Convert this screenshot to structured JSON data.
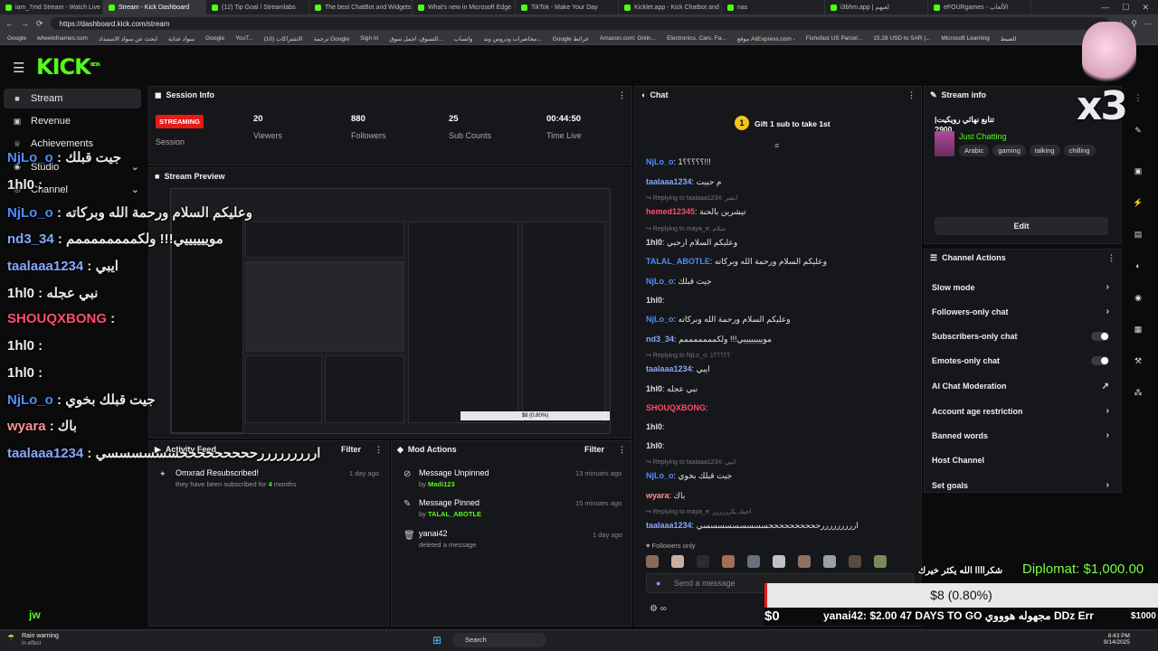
{
  "browser": {
    "tabs": [
      "iam_7md Stream - Watch Live o",
      "Stream - Kick Dashboard",
      "(12) Tip Goal / Streamlabs",
      "The best ChatBot and Widgets",
      "What's new in Microsoft Edge",
      "TikTok - Make Your Day",
      "Kicklet.app - Kick Chatbot and",
      "nas",
      "i3bhm.app | لعبهم",
      "eFOURgames - الألعاب"
    ],
    "url": "https://dashboard.kick.com/stream",
    "bookmarks": [
      "Google",
      "wheelofnames.com",
      "ابحث عن سواد الاستبداد",
      "سواد غداية",
      "Google",
      "YouT...",
      "الاشتراكات (10)",
      "ترجمة Google",
      "Sign In",
      "التسوق، اجمل سوق...",
      "واتساب",
      "محاضرات ودروس وند...",
      "Google خرائط",
      "Amazon.com: Onlin...",
      "Electronics, Cars, Fa...",
      "موقع AliExpress.com -",
      "Fishsfast US Parcel...",
      "15.28 USD to SAR |...",
      "Microsoft Learning",
      "الضبط"
    ]
  },
  "app": {
    "logo": "KICK",
    "logo_beta": "BETA"
  },
  "sidebar": {
    "items": [
      {
        "label": "Stream",
        "icon": "video-icon"
      },
      {
        "label": "Revenue",
        "icon": "dollar-icon"
      },
      {
        "label": "Achievements",
        "icon": "trophy-icon"
      },
      {
        "label": "Studio",
        "icon": "studio-icon"
      },
      {
        "label": "Channel",
        "icon": "channel-icon"
      }
    ],
    "footer_logo": "jw"
  },
  "session": {
    "title": "Session Info",
    "status": "STREAMING",
    "status_label": "Session",
    "stats": [
      {
        "value": "20",
        "label": "Viewers"
      },
      {
        "value": "880",
        "label": "Followers"
      },
      {
        "value": "25",
        "label": "Sub Counts"
      },
      {
        "value": "00:44:50",
        "label": "Time Live"
      }
    ]
  },
  "preview": {
    "title": "Stream Preview"
  },
  "activity": {
    "title": "Activity Feed",
    "filter": "Filter",
    "items": [
      {
        "title": "Omxrad Resubscribed!",
        "sub": "they have been subscribed for",
        "count": "4",
        "unit": "months",
        "time": "1 day ago"
      }
    ]
  },
  "modactions": {
    "title": "Mod Actions",
    "filter": "Filter",
    "items": [
      {
        "title": "Message Unpinned",
        "by": "by",
        "user": "Madi123",
        "time": "13 minutes ago"
      },
      {
        "title": "Message Pinned",
        "by": "by",
        "user": "TALAL_ABOTLE",
        "time": "15 minutes ago"
      },
      {
        "title": "yanai42",
        "by": "deleted a message",
        "user": "",
        "time": "1 day ago"
      }
    ]
  },
  "chat": {
    "title": "Chat",
    "gift": "Gift 1 sub to take 1st",
    "gift_rank": "1",
    "messages": [
      {
        "type": "msg",
        "user": "NjLo_o",
        "text": "؟؟؟؟؟1!!!",
        "color": "#4c8dff"
      },
      {
        "type": "msg",
        "user": "taalaaa1234",
        "text": "م حبيت",
        "color": "#86a8ff"
      },
      {
        "type": "reply",
        "text": "Replying to taalaaa1234: ابشر"
      },
      {
        "type": "msg",
        "user": "hemed12345",
        "text": "تيشرين بالحنة",
        "color": "#ff4d6d"
      },
      {
        "type": "reply",
        "text": "Replying to maya_e: سلام"
      },
      {
        "type": "msg",
        "user": "1hl0",
        "text": "وعليكم السلام ارحبي",
        "color": "#dddddd"
      },
      {
        "type": "msg",
        "user": "TALAL_ABOTLE",
        "text": "وعليكم السلام ورحمة الله وبركاته",
        "color": "#4c8dff"
      },
      {
        "type": "msg",
        "user": "NjLo_o",
        "text": "جيت قبلك",
        "color": "#4c8dff"
      },
      {
        "type": "msg",
        "user": "1hl0",
        "text": "",
        "color": "#dddddd"
      },
      {
        "type": "msg",
        "user": "NjLo_o",
        "text": "وعليكم السلام ورحمة الله وبركاته",
        "color": "#4c8dff"
      },
      {
        "type": "msg",
        "user": "nd3_34",
        "text": "موييييييييي!!! ولكمممممممم",
        "color": "#86a8ff"
      },
      {
        "type": "reply",
        "text": "Replying to NjLo_o: ؟؟؟؟؟1"
      },
      {
        "type": "msg",
        "user": "taalaaa1234",
        "text": "ايبي",
        "color": "#86a8ff"
      },
      {
        "type": "msg",
        "user": "1hl0",
        "text": "نبي عجله",
        "color": "#dddddd"
      },
      {
        "type": "msg",
        "user": "SHOUQXBONG",
        "text": "",
        "color": "#ff4d6d"
      },
      {
        "type": "msg",
        "user": "1hl0",
        "text": "",
        "color": "#dddddd"
      },
      {
        "type": "msg",
        "user": "1hl0",
        "text": "",
        "color": "#dddddd"
      },
      {
        "type": "reply",
        "text": "Replying to taalaaa1234: ابيي"
      },
      {
        "type": "msg",
        "user": "NjLo_o",
        "text": "جيت قبلك بخوي",
        "color": "#4c8dff"
      },
      {
        "type": "msg",
        "user": "wyara",
        "text": "باك",
        "color": "#ff9090"
      },
      {
        "type": "reply",
        "text": "Replying to maya_e: اجيك يكرررررر"
      },
      {
        "type": "msg",
        "user": "taalaaa1234",
        "text": "ارررررررررححححححححححسسسسسسسسسي",
        "color": "#86a8ff"
      }
    ],
    "followers_only": "Followers only",
    "input_placeholder": "Send a message"
  },
  "streaminfo": {
    "title": "Stream info",
    "stream_title": "تتابع نهائي رويكيت| 900?",
    "category": "Just Chatting",
    "tags": [
      "Arabic",
      "gaming",
      "talking",
      "chilling"
    ],
    "edit": "Edit"
  },
  "channelactions": {
    "title": "Channel Actions",
    "items": [
      {
        "label": "Slow mode",
        "control": "chevron"
      },
      {
        "label": "Followers-only chat",
        "control": "chevron"
      },
      {
        "label": "Subscribers-only chat",
        "control": "toggle"
      },
      {
        "label": "Emotes-only chat",
        "control": "toggle"
      },
      {
        "label": "AI Chat Moderation",
        "control": "external"
      },
      {
        "label": "Account age restriction",
        "control": "chevron"
      },
      {
        "label": "Banned words",
        "control": "chevron"
      },
      {
        "label": "Host Channel",
        "control": "none"
      },
      {
        "label": "Set goals",
        "control": "chevron"
      }
    ]
  },
  "overlay": {
    "chat": [
      {
        "user": "NjLo_o",
        "text": ": جيت قبلك",
        "color": "#4c8dff"
      },
      {
        "user": "1hl0",
        "text": ":",
        "color": "#eeeeee"
      },
      {
        "user": "NjLo_o",
        "text": ": وعليكم السلام ورحمة الله وبركاته",
        "color": "#4c8dff"
      },
      {
        "user": "nd3_34",
        "text": ": موييييييي!!! ولكممممممممم",
        "color": "#86a8ff"
      },
      {
        "user": "taalaaa1234",
        "text": ": ايبي",
        "color": "#86a8ff"
      },
      {
        "user": "1hl0",
        "text": ": نبي عجله",
        "color": "#eeeeee"
      },
      {
        "user": "SHOUQXBONG",
        "text": ":",
        "color": "#ff4d6d"
      },
      {
        "user": "1hl0",
        "text": ":",
        "color": "#eeeeee"
      },
      {
        "user": "1hl0",
        "text": ":",
        "color": "#eeeeee"
      },
      {
        "user": "NjLo_o",
        "text": ": جيت قبلك بخوي",
        "color": "#4c8dff"
      },
      {
        "user": "wyara",
        "text": ": باك",
        "color": "#ff9090"
      },
      {
        "user": "taalaaa1234",
        "text": ": ارررررررررحححححححححسسسسسسي",
        "color": "#86a8ff"
      }
    ],
    "multiplier": "x3",
    "goal_label": "Diplomat: $1,000.00",
    "goal_amount": "$8 (0.80%)",
    "goal_progress": 0.008,
    "goal_start": "$0",
    "goal_end": "$1000",
    "thanks": "شكراااا الله يكثر خيرك",
    "ticker": "yanai42: $2.00   47 DAYS TO GO   مجهوله هوووي   DDz Err"
  },
  "taskbar": {
    "weather_title": "Rain warning",
    "weather_sub": "In effect",
    "search": "Search",
    "time": "8:43 PM",
    "date": "9/14/2025"
  },
  "colors": {
    "brand": "#53fc18",
    "live": "#e91916"
  }
}
